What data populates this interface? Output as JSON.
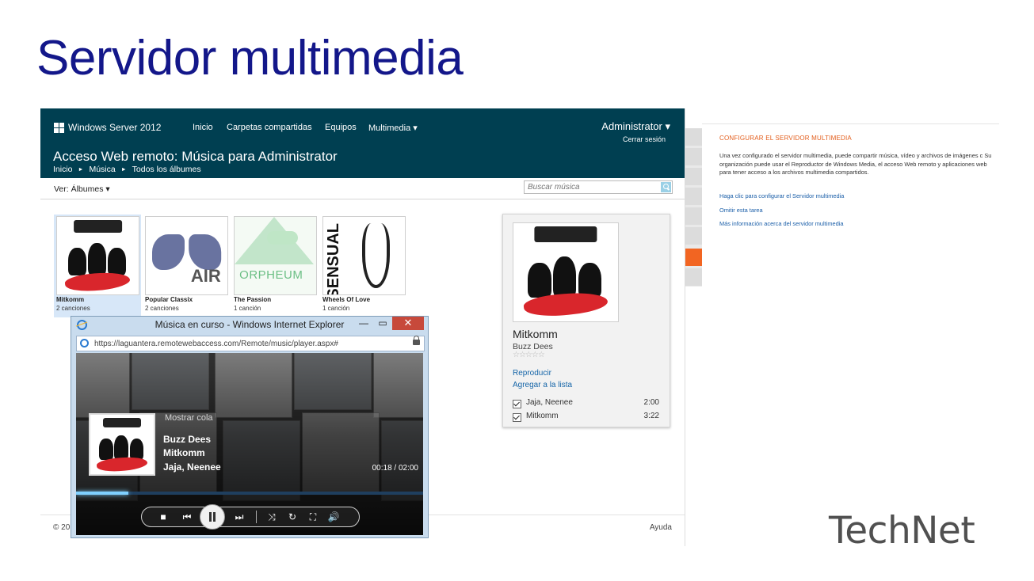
{
  "slide": {
    "title": "Servidor multimedia",
    "brand": "TechNet"
  },
  "config": {
    "title": "CONFIGURAR EL SERVIDOR MULTIMEDIA",
    "description": "Una vez configurado el servidor multimedia, puede compartir música, vídeo y archivos de imágenes c Su organización puede usar el Reproductor de Windows Media, el acceso Web remoto y aplicaciones web para tener acceso a los archivos multimedia compartidos.",
    "links": [
      "Haga clic para configurar el Servidor multimedia",
      "Omitir esta tarea",
      "Más información acerca del servidor multimedia"
    ]
  },
  "webapp": {
    "brand": "Windows Server 2012",
    "nav": [
      "Inicio",
      "Carpetas compartidas",
      "Equipos",
      "Multimedia ▾"
    ],
    "user": "Administrator ▾",
    "signout": "Cerrar sesión",
    "heading": "Acceso Web remoto: Música para Administrator",
    "breadcrumb": [
      "Inicio",
      "Música",
      "Todos los álbumes"
    ],
    "breadcrumb_sep": "►",
    "view_label": "Ver: Álbumes ▾",
    "search_placeholder": "Buscar música",
    "albums": [
      {
        "title": "Mitkomm",
        "count": "2 canciones"
      },
      {
        "title": "Popular Classix",
        "count": "2 canciones"
      },
      {
        "title": "The Passion",
        "count": "1 canción"
      },
      {
        "title": "Wheels Of Love",
        "count": "1 canción"
      }
    ],
    "detail": {
      "title": "Mitkomm",
      "artist": "Buzz Dees",
      "stars": "☆☆☆☆☆",
      "play_link": "Reproducir",
      "add_link": "Agregar a la lista",
      "tracks": [
        {
          "name": "Jaja, Neenee",
          "duration": "2:00"
        },
        {
          "name": "Mitkomm",
          "duration": "3:22"
        }
      ]
    },
    "footer": {
      "copyright": "© 20",
      "help": "Ayuda"
    }
  },
  "player": {
    "window_title": "Música en curso - Windows Internet Explorer",
    "url": "https://laguantera.remotewebaccess.com/Remote/music/player.aspx#",
    "show_queue": "Mostrar cola",
    "artist": "Buzz Dees",
    "album": "Mitkomm",
    "track": "Jaja, Neenee",
    "time": "00:18 / 02:00",
    "progress": 0.15,
    "minimize_glyph": "—",
    "maximize_glyph": "▭",
    "close_glyph": "✕",
    "control_glyphs": {
      "stop": "■",
      "previous": "⏮",
      "next": "⏭",
      "shuffle": "⤨",
      "repeat": "↻",
      "fullscreen": "⛶",
      "volume": "🔊"
    }
  },
  "colors": {
    "header_bg": "#003f51",
    "title_blue": "#13178a",
    "config_orange": "#e35d1b",
    "link_blue": "#1565a8",
    "close_red": "#c7493b"
  }
}
